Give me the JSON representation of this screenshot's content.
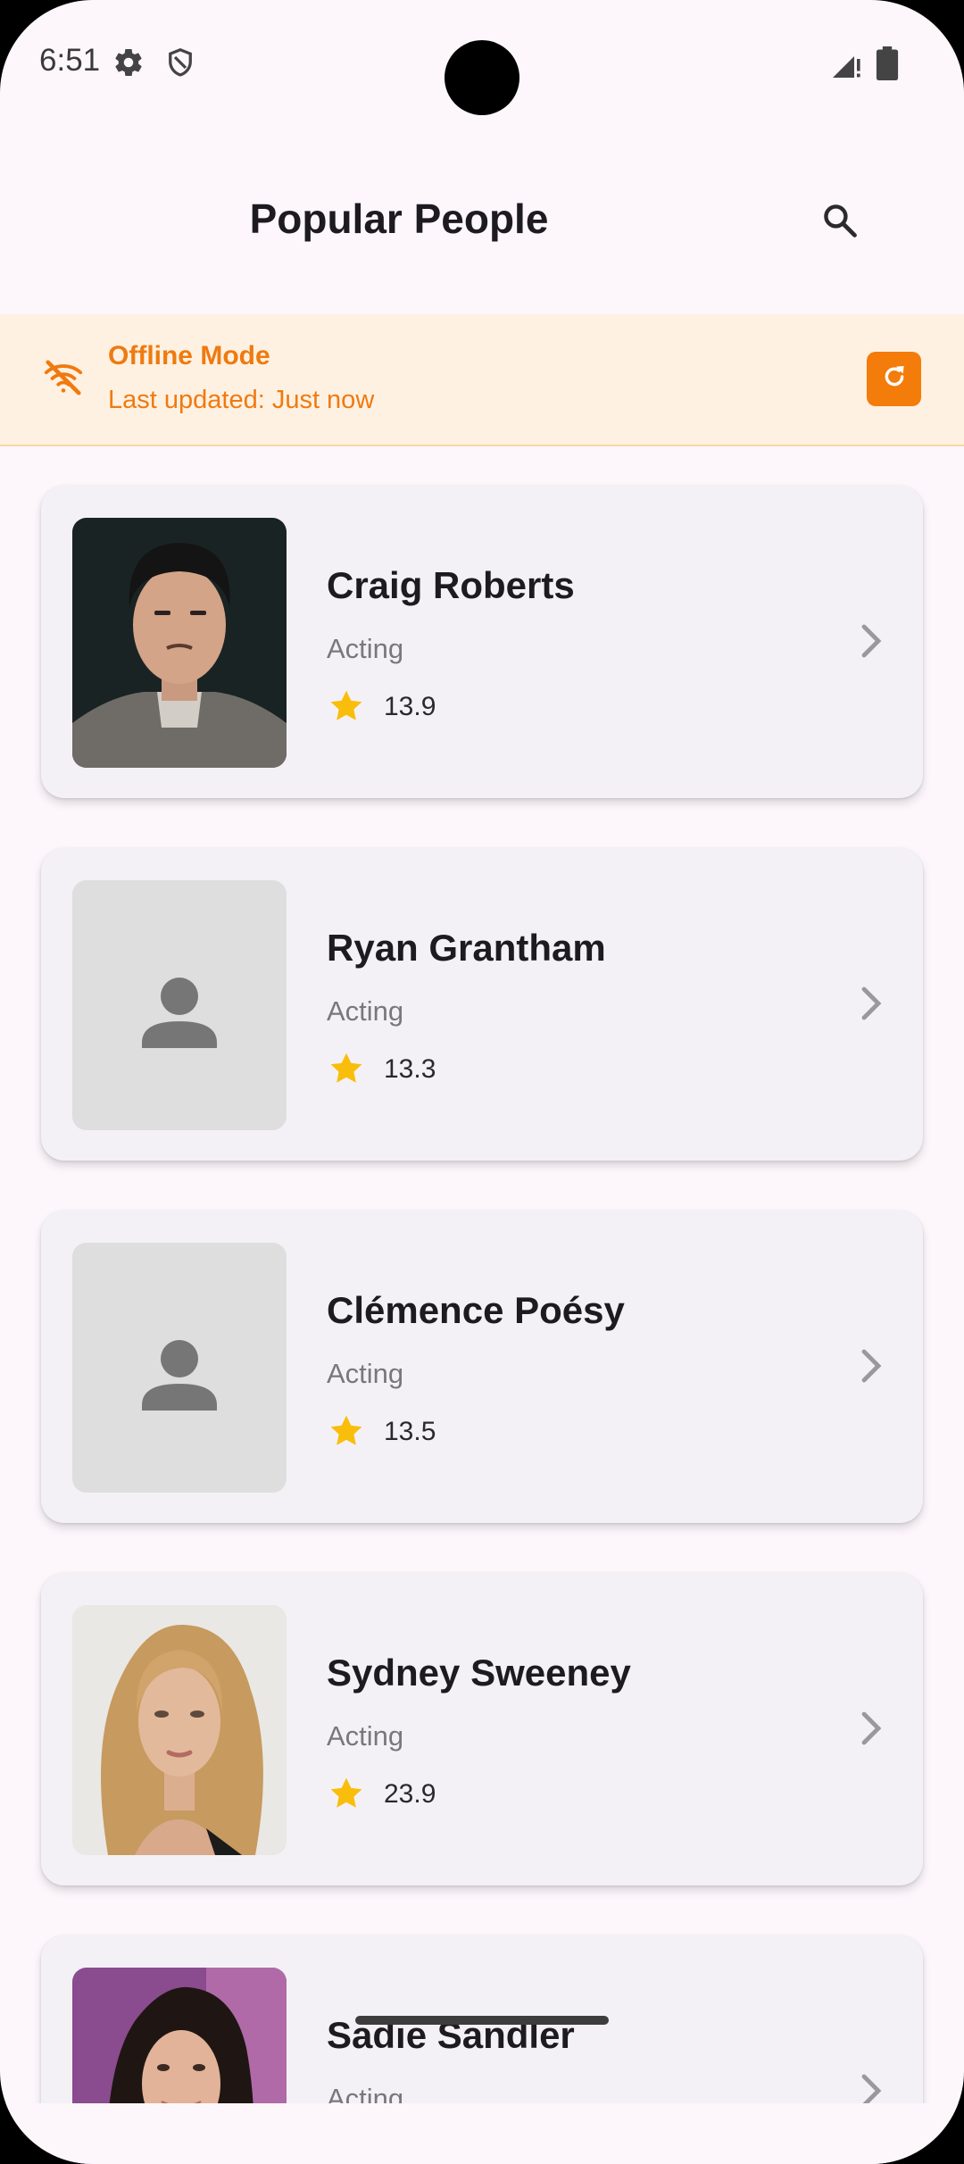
{
  "status_bar": {
    "time": "6:51",
    "icons": [
      "settings-icon",
      "shield-icon",
      "signal-icon",
      "battery-icon"
    ]
  },
  "app_bar": {
    "title": "Popular People",
    "search_icon": "search-icon"
  },
  "offline_banner": {
    "title": "Offline Mode",
    "subtitle": "Last updated: Just now",
    "icon": "wifi-off-icon",
    "refresh_icon": "refresh-icon",
    "accent": "#F47C0A",
    "background": "#FFF1E1"
  },
  "people": [
    {
      "name": "Craig Roberts",
      "department": "Acting",
      "rating": "13.9",
      "photo": "photo"
    },
    {
      "name": "Ryan Grantham",
      "department": "Acting",
      "rating": "13.3",
      "photo": "placeholder"
    },
    {
      "name": "Clémence Poésy",
      "department": "Acting",
      "rating": "13.5",
      "photo": "placeholder"
    },
    {
      "name": "Sydney Sweeney",
      "department": "Acting",
      "rating": "23.9",
      "photo": "photo"
    },
    {
      "name": "Sadie Sandler",
      "department": "Acting",
      "rating": "",
      "photo": "photo"
    }
  ],
  "colors": {
    "star": "#F9BE0B",
    "page_background": "#FDF7FC",
    "card_background": "#F4F1F6"
  }
}
